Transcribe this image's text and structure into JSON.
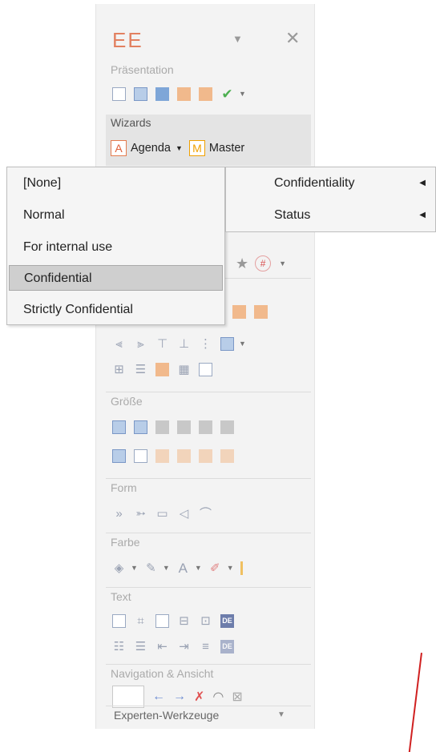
{
  "pane": {
    "title": "EE",
    "groups": {
      "presentation": "Präsentation",
      "wizards": "Wizards",
      "size": "Größe",
      "form": "Form",
      "color": "Farbe",
      "text": "Text",
      "navigation": "Navigation & Ansicht"
    },
    "wizards": {
      "agenda": "Agenda",
      "agenda_letter": "A",
      "master": "Master",
      "master_letter": "M"
    },
    "text_de_badge": "DE",
    "footer": "Experten-Werkzeuge"
  },
  "context_menu": {
    "items": [
      "[None]",
      "Normal",
      "For internal use",
      "Confidential",
      "Strictly Confidential"
    ],
    "selected": "Confidential"
  },
  "submenu": {
    "items": [
      "Confidentiality",
      "Status"
    ]
  },
  "colors": {
    "accent": "#e28060",
    "highlight": "#cfcfcf",
    "check": "#4caf50",
    "annotation": "#d02020"
  }
}
